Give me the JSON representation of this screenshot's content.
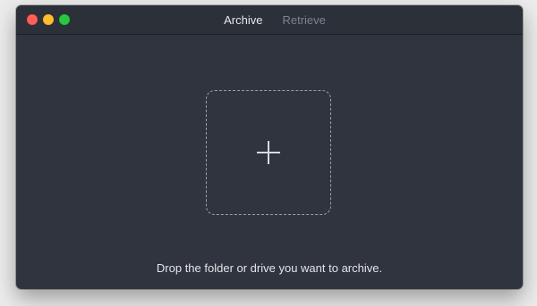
{
  "window": {
    "tabs": [
      {
        "label": "Archive",
        "active": true
      },
      {
        "label": "Retrieve",
        "active": false
      }
    ]
  },
  "dropzone": {
    "icon": "plus-icon",
    "instruction": "Drop the folder or drive you want to archive."
  },
  "colors": {
    "window_bg": "#2f343e",
    "titlebar_bg": "#2b3039",
    "active_tab": "#e6e8ec",
    "inactive_tab": "#7d838e",
    "close": "#fe5f57",
    "minimize": "#febc2e",
    "zoom": "#28c840"
  }
}
